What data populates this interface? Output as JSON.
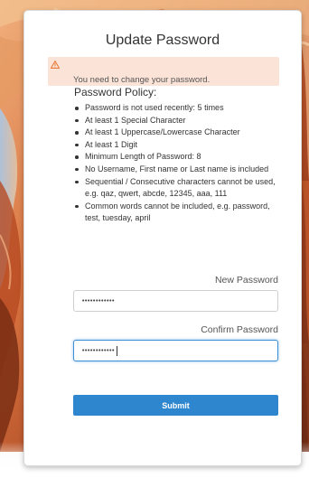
{
  "form": {
    "title": "Update Password",
    "alert_message": "You need to change your password.",
    "policy_title": "Password Policy:",
    "policy_rules": [
      "Password is not used recently: 5 times",
      "At least 1 Special Character",
      "At least 1 Uppercase/Lowercase Character",
      "At least 1 Digit",
      "Minimum Length of Password: 8",
      "No Username, First name or Last name is included",
      "Sequential / Consecutive characters cannot be used, e.g. qaz, qwert, abcde, 12345, aaa, 111",
      "Common words cannot be included, e.g. password, test, tuesday, april"
    ],
    "new_password_label": "New Password",
    "new_password_value": "••••••••••••",
    "confirm_password_label": "Confirm Password",
    "confirm_password_value": "••••••••••••",
    "submit_label": "Submit"
  },
  "icons": {
    "alert": "warning-triangle-icon"
  },
  "colors": {
    "accent": "#2e86cf",
    "alert_background": "#fbe3d7",
    "warning_icon": "#e8732c",
    "focus_border": "#3e8fd6"
  }
}
